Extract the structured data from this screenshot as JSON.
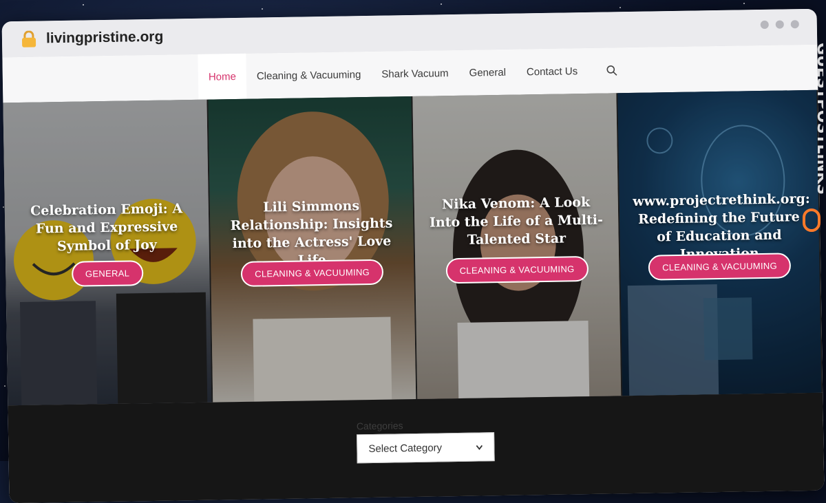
{
  "browser": {
    "url": "livingpristine.org"
  },
  "nav": {
    "items": [
      {
        "label": "Home",
        "active": true
      },
      {
        "label": "Cleaning & Vacuuming",
        "active": false
      },
      {
        "label": "Shark Vacuum",
        "active": false
      },
      {
        "label": "General",
        "active": false
      },
      {
        "label": "Contact Us",
        "active": false
      }
    ],
    "search_icon": "search-icon"
  },
  "posts": [
    {
      "title": "Celebration Emoji: A Fun and Expressive Symbol of Joy",
      "category": "GENERAL"
    },
    {
      "title": "Lili Simmons Relationship: Insights into the Actress' Love Life",
      "category": "CLEANING & VACUUMING"
    },
    {
      "title": "Nika Venom: A Look Into the Life of a Multi-Talented Star",
      "category": "CLEANING & VACUUMING"
    },
    {
      "title": "www.projectrethink.org: Redefining the Future of Education and Innovation",
      "category": "CLEANING & VACUUMING"
    }
  ],
  "sidebar": {
    "categories_label": "Categories",
    "select_value": "Select Category"
  },
  "watermark": "GUESTPOSTLINKS",
  "colors": {
    "accent": "#d6336c",
    "hero_bg": "#1b1b1b"
  }
}
